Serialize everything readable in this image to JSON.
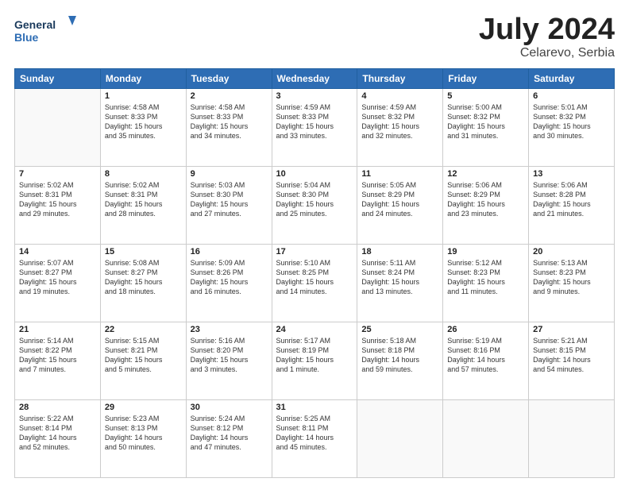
{
  "header": {
    "logo_line1": "General",
    "logo_line2": "Blue",
    "title": "July 2024",
    "location": "Celarevo, Serbia"
  },
  "weekdays": [
    "Sunday",
    "Monday",
    "Tuesday",
    "Wednesday",
    "Thursday",
    "Friday",
    "Saturday"
  ],
  "weeks": [
    [
      {
        "day": "",
        "content": ""
      },
      {
        "day": "1",
        "content": "Sunrise: 4:58 AM\nSunset: 8:33 PM\nDaylight: 15 hours\nand 35 minutes."
      },
      {
        "day": "2",
        "content": "Sunrise: 4:58 AM\nSunset: 8:33 PM\nDaylight: 15 hours\nand 34 minutes."
      },
      {
        "day": "3",
        "content": "Sunrise: 4:59 AM\nSunset: 8:33 PM\nDaylight: 15 hours\nand 33 minutes."
      },
      {
        "day": "4",
        "content": "Sunrise: 4:59 AM\nSunset: 8:32 PM\nDaylight: 15 hours\nand 32 minutes."
      },
      {
        "day": "5",
        "content": "Sunrise: 5:00 AM\nSunset: 8:32 PM\nDaylight: 15 hours\nand 31 minutes."
      },
      {
        "day": "6",
        "content": "Sunrise: 5:01 AM\nSunset: 8:32 PM\nDaylight: 15 hours\nand 30 minutes."
      }
    ],
    [
      {
        "day": "7",
        "content": "Sunrise: 5:02 AM\nSunset: 8:31 PM\nDaylight: 15 hours\nand 29 minutes."
      },
      {
        "day": "8",
        "content": "Sunrise: 5:02 AM\nSunset: 8:31 PM\nDaylight: 15 hours\nand 28 minutes."
      },
      {
        "day": "9",
        "content": "Sunrise: 5:03 AM\nSunset: 8:30 PM\nDaylight: 15 hours\nand 27 minutes."
      },
      {
        "day": "10",
        "content": "Sunrise: 5:04 AM\nSunset: 8:30 PM\nDaylight: 15 hours\nand 25 minutes."
      },
      {
        "day": "11",
        "content": "Sunrise: 5:05 AM\nSunset: 8:29 PM\nDaylight: 15 hours\nand 24 minutes."
      },
      {
        "day": "12",
        "content": "Sunrise: 5:06 AM\nSunset: 8:29 PM\nDaylight: 15 hours\nand 23 minutes."
      },
      {
        "day": "13",
        "content": "Sunrise: 5:06 AM\nSunset: 8:28 PM\nDaylight: 15 hours\nand 21 minutes."
      }
    ],
    [
      {
        "day": "14",
        "content": "Sunrise: 5:07 AM\nSunset: 8:27 PM\nDaylight: 15 hours\nand 19 minutes."
      },
      {
        "day": "15",
        "content": "Sunrise: 5:08 AM\nSunset: 8:27 PM\nDaylight: 15 hours\nand 18 minutes."
      },
      {
        "day": "16",
        "content": "Sunrise: 5:09 AM\nSunset: 8:26 PM\nDaylight: 15 hours\nand 16 minutes."
      },
      {
        "day": "17",
        "content": "Sunrise: 5:10 AM\nSunset: 8:25 PM\nDaylight: 15 hours\nand 14 minutes."
      },
      {
        "day": "18",
        "content": "Sunrise: 5:11 AM\nSunset: 8:24 PM\nDaylight: 15 hours\nand 13 minutes."
      },
      {
        "day": "19",
        "content": "Sunrise: 5:12 AM\nSunset: 8:23 PM\nDaylight: 15 hours\nand 11 minutes."
      },
      {
        "day": "20",
        "content": "Sunrise: 5:13 AM\nSunset: 8:23 PM\nDaylight: 15 hours\nand 9 minutes."
      }
    ],
    [
      {
        "day": "21",
        "content": "Sunrise: 5:14 AM\nSunset: 8:22 PM\nDaylight: 15 hours\nand 7 minutes."
      },
      {
        "day": "22",
        "content": "Sunrise: 5:15 AM\nSunset: 8:21 PM\nDaylight: 15 hours\nand 5 minutes."
      },
      {
        "day": "23",
        "content": "Sunrise: 5:16 AM\nSunset: 8:20 PM\nDaylight: 15 hours\nand 3 minutes."
      },
      {
        "day": "24",
        "content": "Sunrise: 5:17 AM\nSunset: 8:19 PM\nDaylight: 15 hours\nand 1 minute."
      },
      {
        "day": "25",
        "content": "Sunrise: 5:18 AM\nSunset: 8:18 PM\nDaylight: 14 hours\nand 59 minutes."
      },
      {
        "day": "26",
        "content": "Sunrise: 5:19 AM\nSunset: 8:16 PM\nDaylight: 14 hours\nand 57 minutes."
      },
      {
        "day": "27",
        "content": "Sunrise: 5:21 AM\nSunset: 8:15 PM\nDaylight: 14 hours\nand 54 minutes."
      }
    ],
    [
      {
        "day": "28",
        "content": "Sunrise: 5:22 AM\nSunset: 8:14 PM\nDaylight: 14 hours\nand 52 minutes."
      },
      {
        "day": "29",
        "content": "Sunrise: 5:23 AM\nSunset: 8:13 PM\nDaylight: 14 hours\nand 50 minutes."
      },
      {
        "day": "30",
        "content": "Sunrise: 5:24 AM\nSunset: 8:12 PM\nDaylight: 14 hours\nand 47 minutes."
      },
      {
        "day": "31",
        "content": "Sunrise: 5:25 AM\nSunset: 8:11 PM\nDaylight: 14 hours\nand 45 minutes."
      },
      {
        "day": "",
        "content": ""
      },
      {
        "day": "",
        "content": ""
      },
      {
        "day": "",
        "content": ""
      }
    ]
  ]
}
